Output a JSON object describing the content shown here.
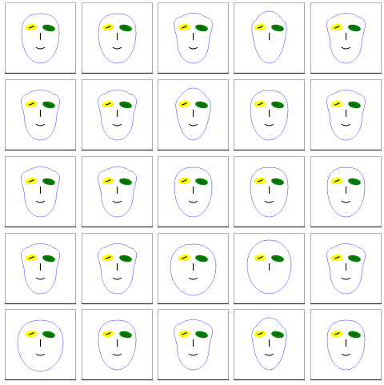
{
  "colors": {
    "background": "#ffffff",
    "frame": "#333333",
    "face_outline": "#1a1aff",
    "left_eye": "#ffff00",
    "right_eye": "#008000",
    "pupil": "#000000",
    "nose": "#000000",
    "mouth": "#000000"
  },
  "icons": {
    "face": "cartoon-face-icon",
    "left_eye": "yellow-eye-icon",
    "right_eye": "green-eye-icon"
  },
  "grid": {
    "rows": 5,
    "columns": 5,
    "faces": [
      {
        "head": "round",
        "mouth": "smile"
      },
      {
        "head": "round",
        "mouth": "smile"
      },
      {
        "head": "lumpy",
        "mouth": "smile"
      },
      {
        "head": "peaked",
        "mouth": "none"
      },
      {
        "head": "lumpy",
        "mouth": "smile"
      },
      {
        "head": "lumpy",
        "mouth": "smile"
      },
      {
        "head": "lumpy",
        "mouth": "smile"
      },
      {
        "head": "peaked",
        "mouth": "smile"
      },
      {
        "head": "round",
        "mouth": "smile"
      },
      {
        "head": "lumpy",
        "mouth": "smile"
      },
      {
        "head": "lumpy",
        "mouth": "smile"
      },
      {
        "head": "lumpy",
        "mouth": "smile"
      },
      {
        "head": "round",
        "mouth": "smile"
      },
      {
        "head": "round",
        "mouth": "smile"
      },
      {
        "head": "round",
        "mouth": "smile"
      },
      {
        "head": "lumpy",
        "mouth": "smile"
      },
      {
        "head": "lumpy",
        "mouth": "smile"
      },
      {
        "head": "wide",
        "mouth": "smile"
      },
      {
        "head": "oval",
        "mouth": "none"
      },
      {
        "head": "lumpy",
        "mouth": "smile"
      },
      {
        "head": "wide",
        "mouth": "smile"
      },
      {
        "head": "round",
        "mouth": "smile"
      },
      {
        "head": "lumpy",
        "mouth": "smile"
      },
      {
        "head": "peaked",
        "mouth": "smile"
      },
      {
        "head": "round",
        "mouth": "smile"
      }
    ]
  }
}
